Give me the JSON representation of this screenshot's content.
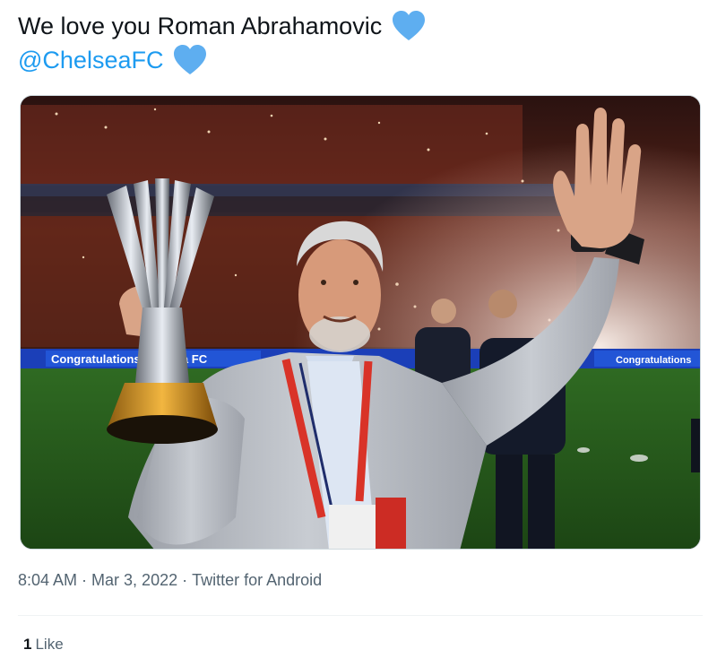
{
  "tweet": {
    "text_line": "We love you Roman Abrahamovic",
    "mention": "@ChelseaFC",
    "emoji_icon": "blue-heart-icon",
    "heart_color": "#5eaef0"
  },
  "media": {
    "banner_text_left": "Congratulations Chelsea FC",
    "banner_text_right": "Congratulations"
  },
  "meta": {
    "time": "8:04 AM",
    "separator": " · ",
    "date": "Mar 3, 2022",
    "source": "Twitter for Android"
  },
  "engagement": {
    "like_count": "1",
    "like_label": "Like"
  },
  "colors": {
    "text": "#0f1419",
    "secondary": "#536471",
    "link": "#1d9bf0",
    "divider": "#eff3f4"
  }
}
